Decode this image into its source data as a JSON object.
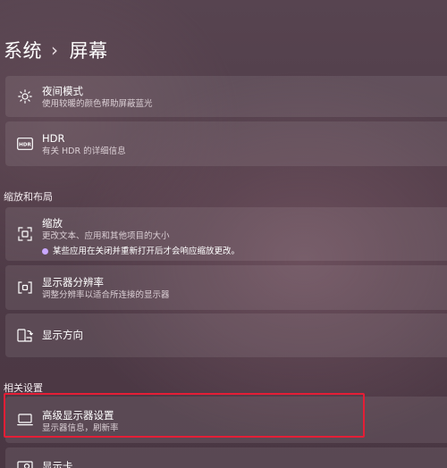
{
  "breadcrumb": {
    "parent": "系统",
    "separator": "›",
    "current": "屏幕"
  },
  "cards": {
    "night_light": {
      "icon": "brightness-icon",
      "title": "夜间模式",
      "desc": "使用较暖的颜色帮助屏蔽蓝光"
    },
    "hdr": {
      "icon": "hdr-icon",
      "title": "HDR",
      "desc": "有关 HDR 的详细信息"
    },
    "scale": {
      "icon": "scale-icon",
      "title": "缩放",
      "desc": "更改文本、应用和其他项目的大小",
      "note": "某些应用在关闭并重新打开后才会响应缩放更改。"
    },
    "resolution": {
      "icon": "resolution-icon",
      "title": "显示器分辨率",
      "desc": "调整分辨率以适合所连接的显示器"
    },
    "orientation": {
      "icon": "orientation-icon",
      "title": "显示方向"
    },
    "advanced": {
      "icon": "monitor-icon",
      "title": "高级显示器设置",
      "desc": "显示器信息，刷新率"
    },
    "graphics": {
      "icon": "graphics-icon",
      "title": "显示卡"
    }
  },
  "sections": {
    "scale_layout": "缩放和布局",
    "related": "相关设置"
  },
  "colors": {
    "highlight_border": "#e41e36",
    "note_dot": "#c9a8ff"
  }
}
